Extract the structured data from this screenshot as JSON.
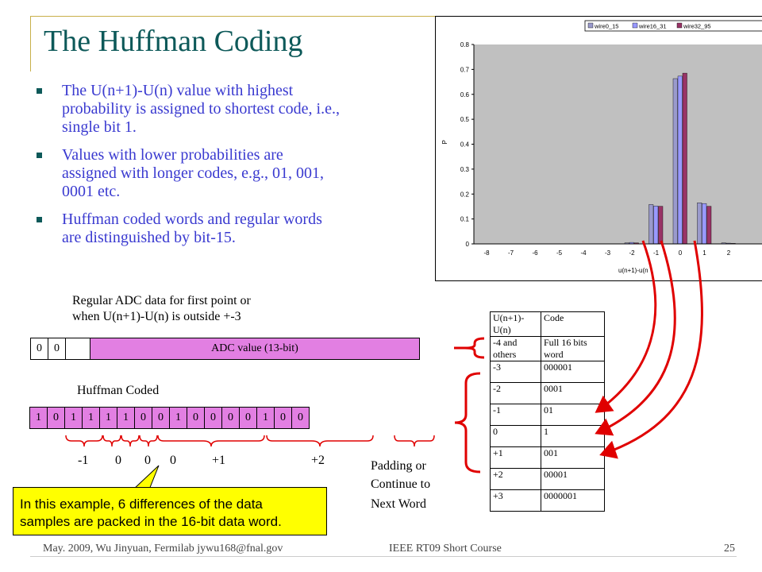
{
  "slide": {
    "title": "The Huffman Coding",
    "bullets": [
      "The U(n+1)-U(n) value with highest probability is assigned to shortest code, i.e., single bit 1.",
      "Values with lower probabilities are assigned with longer codes, e.g., 01, 001, 0001 etc.",
      "Huffman coded words and regular words are distinguished by bit-15."
    ]
  },
  "regular": {
    "caption_line1": "Regular ADC data for first point or",
    "caption_line2": "when U(n+1)-U(n) is outside +-3",
    "bits": [
      "0",
      "0",
      ""
    ],
    "adc_label": "ADC value (13-bit)"
  },
  "huffman": {
    "caption": "Huffman Coded",
    "bits": [
      "1",
      "0",
      "1",
      "1",
      "1",
      "1",
      "0",
      "0",
      "1",
      "0",
      "0",
      "0",
      "0",
      "1",
      "0",
      "0"
    ],
    "values": [
      "-1",
      "0",
      "0",
      "0",
      "+1",
      "+2"
    ],
    "padding_line1": "Padding or",
    "padding_line2": "Continue to",
    "padding_line3": "Next Word"
  },
  "table": {
    "header": [
      "U(n+1)-U(n)",
      "Code"
    ],
    "rows": [
      [
        "-4 and others",
        "Full 16 bits word"
      ],
      [
        "-3",
        "000001"
      ],
      [
        "-2",
        "0001"
      ],
      [
        "-1",
        "01"
      ],
      [
        "0",
        "1"
      ],
      [
        "+1",
        "001"
      ],
      [
        "+2",
        "00001"
      ],
      [
        "+3",
        "0000001"
      ]
    ]
  },
  "note": {
    "line1": "In this example, 6 differences of the data",
    "line2": "samples are packed in the 16-bit data word."
  },
  "footer": {
    "left": "May. 2009, Wu Jinyuan, Fermilab jywu168@fnal.gov",
    "center": "IEEE RT09 Short Course",
    "right": "25"
  },
  "colors": {
    "title": "#0d5959",
    "bullet_text": "#3a3ad0",
    "adc_fill": "#e27fe2",
    "note_fill": "#ffff00",
    "arrow": "#e00000"
  },
  "chart_data": {
    "type": "bar",
    "categories": [
      "-8",
      "-7",
      "-6",
      "-5",
      "-4",
      "-3",
      "-2",
      "-1",
      "0",
      "1",
      "2"
    ],
    "series": [
      {
        "name": "wire0_15",
        "color": "#9a9acc",
        "values": [
          0,
          0,
          0,
          0,
          0,
          0,
          0.004,
          0.158,
          0.663,
          0.165,
          0.004
        ]
      },
      {
        "name": "wire16_31",
        "color": "#9999ff",
        "values": [
          0,
          0,
          0,
          0,
          0,
          0,
          0.006,
          0.152,
          0.673,
          0.162,
          0.003
        ]
      },
      {
        "name": "wire32_95",
        "color": "#993366",
        "values": [
          0,
          0,
          0,
          0,
          0,
          0,
          0.004,
          0.151,
          0.685,
          0.151,
          0.002
        ]
      }
    ],
    "ylim": [
      0,
      0.8
    ],
    "yticks": [
      "0",
      "0.1",
      "0.2",
      "0.3",
      "0.4",
      "0.5",
      "0.6",
      "0.7",
      "0.8"
    ],
    "ylabel": "P",
    "xlabel": "u(n+1)-u(n",
    "legend": "top-right",
    "plot_bg": "#c0c0c0"
  }
}
